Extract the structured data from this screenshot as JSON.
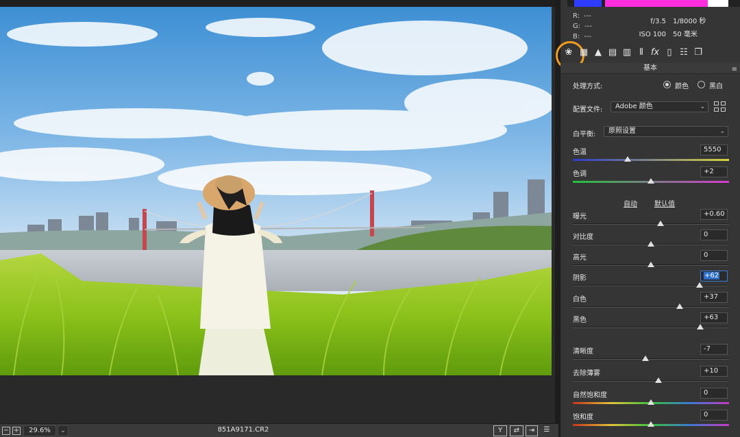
{
  "viewport": {
    "zoom_level": "29.6%",
    "filename": "851A9171.CR2"
  },
  "histogram": {
    "bar_colors": [
      "#2d3cff",
      "#ff2de0",
      "#ffffff",
      "#2a9bff"
    ]
  },
  "readout": {
    "r_label": "R:",
    "r_value": "---",
    "g_label": "G:",
    "g_value": "---",
    "b_label": "B:",
    "b_value": "---"
  },
  "camera": {
    "aperture": "f/3.5",
    "shutter": "1/8000 秒",
    "iso": "ISO 100",
    "focal": "50 毫米"
  },
  "tools": [
    "basic-tool-icon",
    "tone-curve-icon",
    "detail-icon",
    "hsl-icon",
    "split-toning-icon",
    "lens-corrections-icon",
    "effects-icon",
    "camera-calibration-icon",
    "presets-icon",
    "snapshots-icon"
  ],
  "tool_fx": "fx",
  "section": {
    "title": "基本",
    "menu": "≡"
  },
  "treatment": {
    "label": "处理方式:",
    "color": "颜色",
    "bw": "黑白",
    "selected": "颜色"
  },
  "profile": {
    "label": "配置文件:",
    "value": "Adobe 颜色"
  },
  "white_balance": {
    "label": "白平衡:",
    "value": "原照设置"
  },
  "sliders": [
    {
      "key": "temp",
      "label": "色温",
      "value": "5550",
      "pos": 0.35
    },
    {
      "key": "tint",
      "label": "色调",
      "value": "+2",
      "pos": 0.5
    },
    {
      "key": "exposure",
      "label": "曝光",
      "value": "+0.60",
      "pos": 0.56
    },
    {
      "key": "contrast",
      "label": "对比度",
      "value": "0",
      "pos": 0.5
    },
    {
      "key": "highlights",
      "label": "高光",
      "value": "0",
      "pos": 0.5
    },
    {
      "key": "shadows",
      "label": "阴影",
      "value": "+62",
      "pos": 0.81
    },
    {
      "key": "whites",
      "label": "白色",
      "value": "+37",
      "pos": 0.685
    },
    {
      "key": "blacks",
      "label": "黑色",
      "value": "+63",
      "pos": 0.815
    },
    {
      "key": "clarity",
      "label": "清晰度",
      "value": "-7",
      "pos": 0.465
    },
    {
      "key": "dehaze",
      "label": "去除薄雾",
      "value": "+10",
      "pos": 0.55
    },
    {
      "key": "vibrance",
      "label": "自然饱和度",
      "value": "0",
      "pos": 0.5
    },
    {
      "key": "saturation",
      "label": "饱和度",
      "value": "0",
      "pos": 0.5
    }
  ],
  "tone_links": {
    "auto": "自动",
    "default": "默认值"
  },
  "highlight_color": "#f39c1f"
}
